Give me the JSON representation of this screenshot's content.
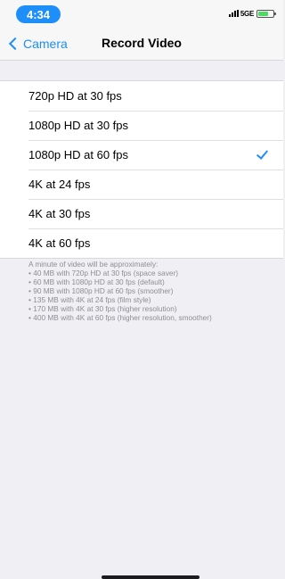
{
  "status_bar": {
    "time": "4:34",
    "network": "5GE"
  },
  "nav": {
    "back_label": "Camera",
    "title": "Record Video"
  },
  "options": [
    {
      "label": "720p HD at 30 fps",
      "selected": false
    },
    {
      "label": "1080p HD at 30 fps",
      "selected": false
    },
    {
      "label": "1080p HD at 60 fps",
      "selected": true
    },
    {
      "label": "4K at 24 fps",
      "selected": false
    },
    {
      "label": "4K at 30 fps",
      "selected": false
    },
    {
      "label": "4K at 60 fps",
      "selected": false
    }
  ],
  "footer": {
    "intro": "A minute of video will be approximately:",
    "lines": [
      "• 40 MB with 720p HD at 30 fps (space saver)",
      "• 60 MB with 1080p HD at 30 fps (default)",
      "• 90 MB with 1080p HD at 60 fps (smoother)",
      "• 135 MB with 4K at 24 fps (film style)",
      "• 170 MB with 4K at 30 fps (higher resolution)",
      "• 400 MB with 4K at 60 fps (higher resolution, smoother)"
    ]
  },
  "colors": {
    "accent": "#1e8ef8",
    "background": "#efeff4",
    "battery": "#4cd964"
  }
}
